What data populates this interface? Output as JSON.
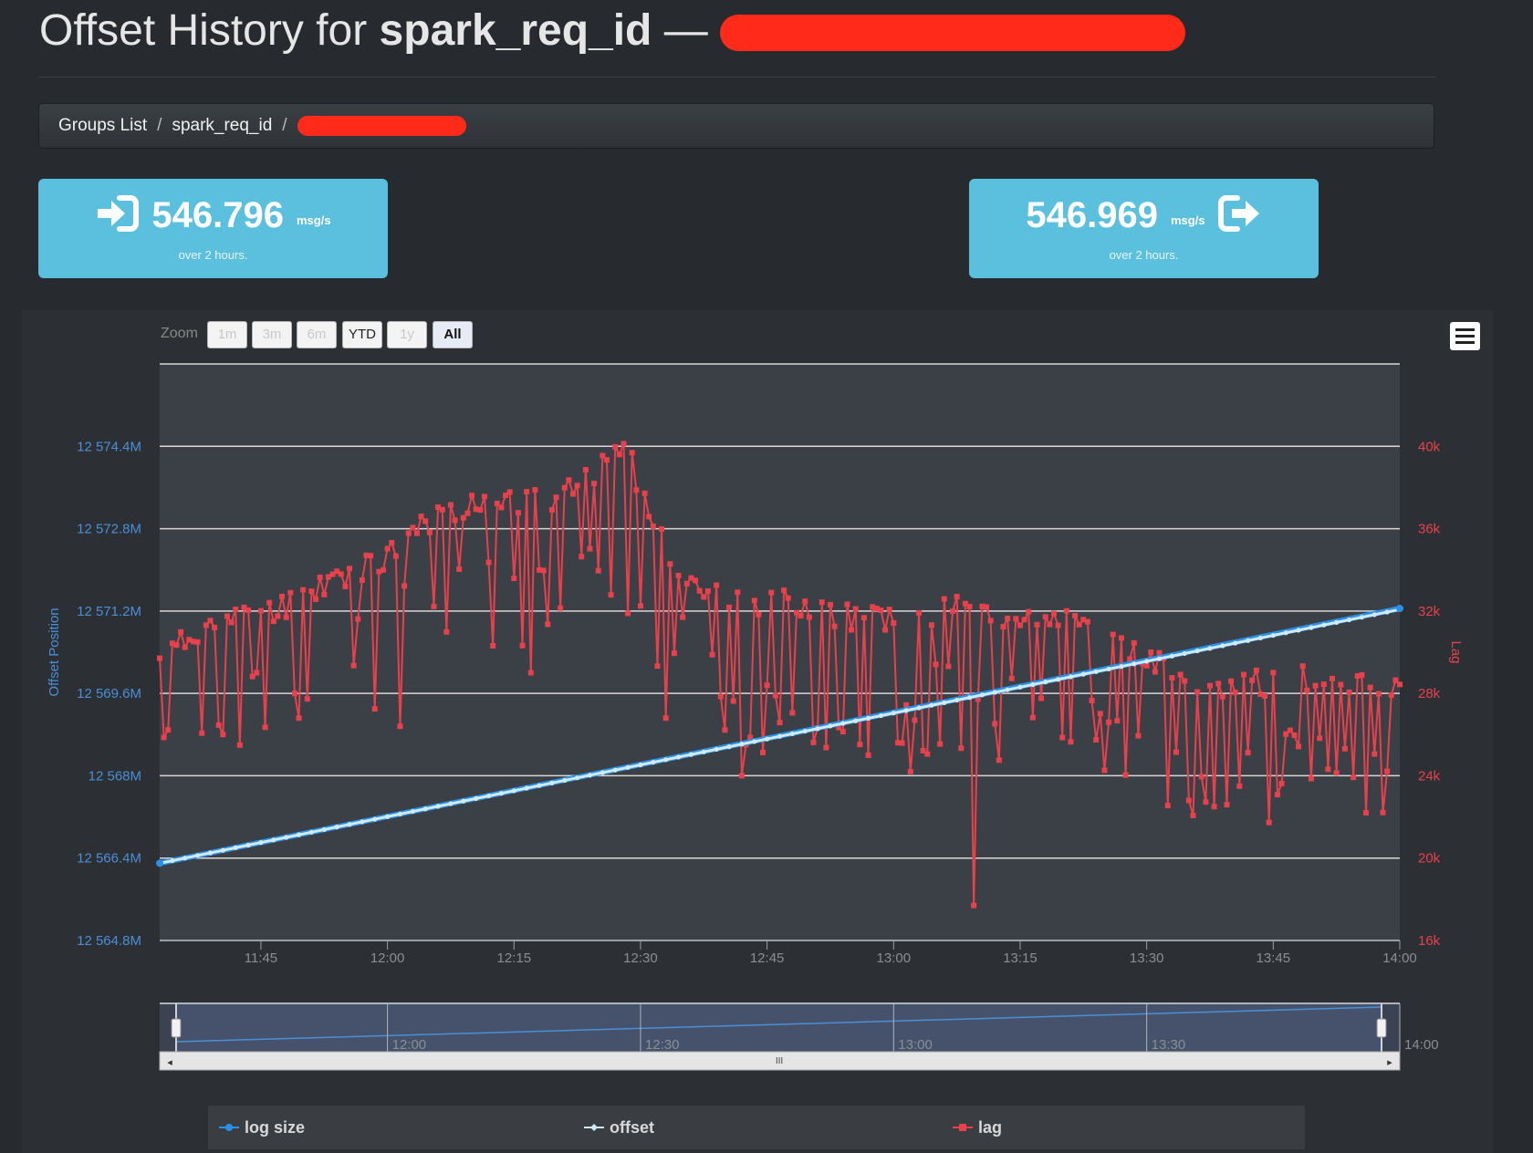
{
  "header": {
    "title_prefix": "Offset History for",
    "group_name": "spark_req_id",
    "dash": "—"
  },
  "breadcrumb": {
    "items": [
      "Groups List",
      "spark_req_id"
    ],
    "separator": "/"
  },
  "rates": {
    "consume": {
      "value": "546.796",
      "unit": "msg/s",
      "period": "over 2 hours.",
      "icon": "sign-in-icon"
    },
    "produce": {
      "value": "546.969",
      "unit": "msg/s",
      "period": "over 2 hours.",
      "icon": "sign-out-icon"
    }
  },
  "zoom": {
    "label": "Zoom",
    "buttons": [
      {
        "label": "1m",
        "state": "disabled"
      },
      {
        "label": "3m",
        "state": "disabled"
      },
      {
        "label": "6m",
        "state": "disabled"
      },
      {
        "label": "YTD",
        "state": "enabled"
      },
      {
        "label": "1y",
        "state": "disabled"
      },
      {
        "label": "All",
        "state": "active"
      }
    ]
  },
  "navigator": {
    "ticks": [
      "12:00",
      "12:30",
      "13:00",
      "13:30",
      "14:00"
    ],
    "scroll_grip": "III"
  },
  "legend": [
    {
      "name": "log size",
      "color": "#2b90e8"
    },
    {
      "name": "offset",
      "color": "#cfeaf3"
    },
    {
      "name": "lag",
      "color": "#e8414b"
    }
  ],
  "chart_data": {
    "type": "line",
    "x_ticks": [
      "11:45",
      "12:00",
      "12:15",
      "12:30",
      "12:45",
      "13:00",
      "13:15",
      "13:30",
      "13:45",
      "14:00"
    ],
    "x_range": [
      "11:33",
      "14:00"
    ],
    "y_left": {
      "label": "Offset Position",
      "ticks": [
        "12 564.8M",
        "12 566.4M",
        "12 568M",
        "12 569.6M",
        "12 571.2M",
        "12 572.8M",
        "12 574.4M"
      ],
      "range": [
        12564.8,
        12576.0
      ],
      "unit": "M",
      "color": "#4a8fd6"
    },
    "y_right": {
      "label": "Lag",
      "ticks": [
        "16k",
        "20k",
        "24k",
        "28k",
        "32k",
        "36k",
        "40k"
      ],
      "range": [
        16000,
        44000
      ],
      "color": "#e8414b"
    },
    "grid": true,
    "series": [
      {
        "name": "log size",
        "axis": "left",
        "color": "#2b90e8",
        "x_minutes": [
          0,
          147
        ],
        "values": [
          12566.3,
          12571.25
        ]
      },
      {
        "name": "offset",
        "axis": "left",
        "color": "#cfeaf3",
        "x_minutes": [
          0,
          147
        ],
        "values": [
          12566.3,
          12571.23
        ]
      },
      {
        "name": "lag",
        "axis": "right",
        "color": "#e8414b",
        "baseline_x_minutes": [
          0,
          5,
          10,
          15,
          20,
          25,
          30,
          35,
          40,
          45,
          50,
          55,
          60,
          65,
          70,
          75,
          80,
          85,
          90,
          95,
          100,
          105,
          110,
          115,
          120,
          125,
          130,
          135,
          140,
          147
        ],
        "baseline_values": [
          29500,
          31200,
          31800,
          32300,
          33500,
          34200,
          35800,
          37000,
          37600,
          37200,
          38000,
          40000,
          35000,
          33000,
          32000,
          32500,
          31800,
          31700,
          31500,
          32200,
          31800,
          31200,
          31500,
          30000,
          29000,
          27800,
          28500,
          28700,
          28700,
          28100
        ],
        "dips": [
          {
            "x_minutes": 11.7,
            "value": 29000
          },
          {
            "x_minutes": 16.5,
            "value": 26800
          },
          {
            "x_minutes": 28.5,
            "value": 26400
          },
          {
            "x_minutes": 44,
            "value": 29000
          },
          {
            "x_minutes": 60,
            "value": 26800
          },
          {
            "x_minutes": 69,
            "value": 24000
          },
          {
            "x_minutes": 89,
            "value": 24200
          },
          {
            "x_minutes": 96.5,
            "value": 17700
          },
          {
            "x_minutes": 122,
            "value": 22800
          },
          {
            "x_minutes": 125,
            "value": 22500
          },
          {
            "x_minutes": 143,
            "value": 22200
          }
        ]
      }
    ]
  }
}
